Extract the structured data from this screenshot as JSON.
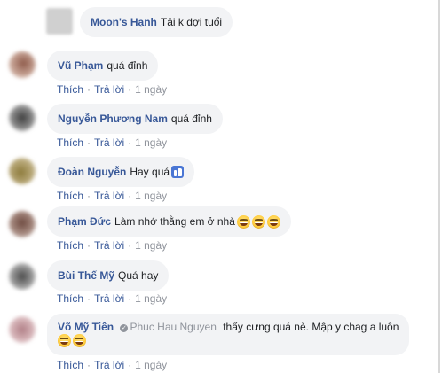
{
  "colors": {
    "name": "#385898",
    "bubble": "#f2f3f5",
    "meta": "#90949c"
  },
  "labels": {
    "like": "Thích",
    "reply": "Trả lời",
    "sep": "·"
  },
  "comments": [
    {
      "name": "Moon's Hạnh",
      "text": "Tải k đợi tuổi",
      "time": ""
    },
    {
      "name": "Vũ Phạm",
      "text": "quá đỉnh",
      "time": "1 ngày"
    },
    {
      "name": "Nguyễn Phương Nam",
      "text": "quá đỉnh",
      "time": "1 ngày"
    },
    {
      "name": "Đoàn Nguyễn",
      "text": "Hay quá",
      "time": "1 ngày",
      "icon": "like-thumb-icon"
    },
    {
      "name": "Phạm Đức",
      "text": "Làm nhớ thằng em ở nhà",
      "time": "1 ngày",
      "icon": "grinning-sweat-emoji"
    },
    {
      "name": "Bùi Thế Mỹ",
      "text": "Quá hay",
      "time": "1 ngày"
    },
    {
      "name": "Võ Mỹ Tiên",
      "tag": "Phuc Hau Nguyen",
      "text": "thấy cưng quá nè. Mập y chag a luôn",
      "time": "1 ngày",
      "icon": "grinning-sweat-emoji"
    }
  ]
}
